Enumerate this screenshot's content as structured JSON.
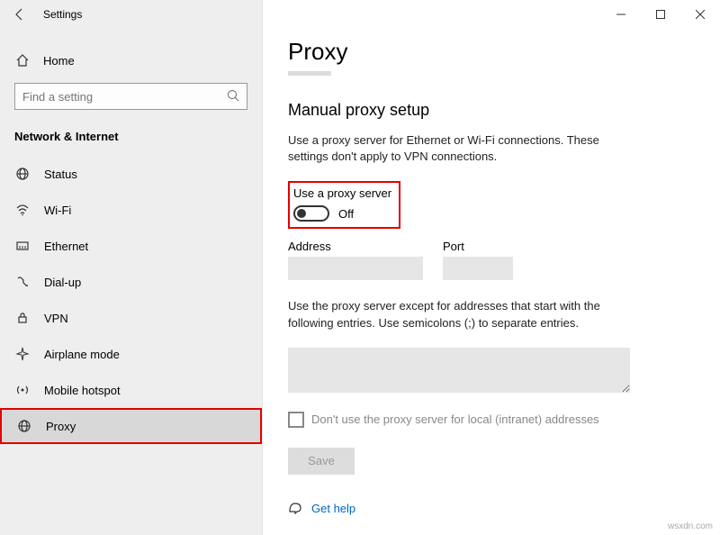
{
  "window": {
    "title": "Settings"
  },
  "sidebar": {
    "home": "Home",
    "search_placeholder": "Find a setting",
    "category": "Network & Internet",
    "items": [
      {
        "label": "Status"
      },
      {
        "label": "Wi-Fi"
      },
      {
        "label": "Ethernet"
      },
      {
        "label": "Dial-up"
      },
      {
        "label": "VPN"
      },
      {
        "label": "Airplane mode"
      },
      {
        "label": "Mobile hotspot"
      },
      {
        "label": "Proxy"
      }
    ]
  },
  "main": {
    "title": "Proxy",
    "section": "Manual proxy setup",
    "desc": "Use a proxy server for Ethernet or Wi-Fi connections. These settings don't apply to VPN connections.",
    "toggle_label": "Use a proxy server",
    "toggle_state": "Off",
    "address_label": "Address",
    "port_label": "Port",
    "exceptions_desc": "Use the proxy server except for addresses that start with the following entries. Use semicolons (;) to separate entries.",
    "local_checkbox": "Don't use the proxy server for local (intranet) addresses",
    "save": "Save",
    "help": "Get help"
  },
  "watermark": "wsxdn.com"
}
